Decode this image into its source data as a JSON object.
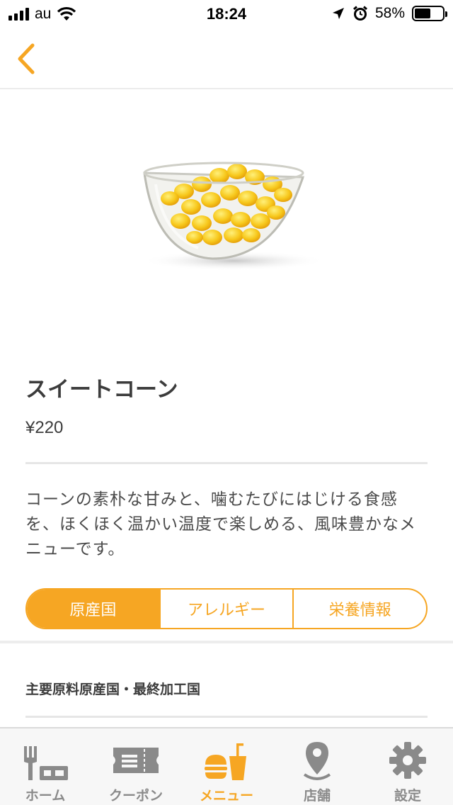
{
  "status_bar": {
    "carrier": "au",
    "time": "18:24",
    "battery_text": "58%",
    "battery_level": 0.58
  },
  "nav": {
    "back_icon": "chevron-left-icon"
  },
  "product": {
    "name": "スイートコーン",
    "price": "¥220",
    "description": "コーンの素朴な甘みと、噛むたびにはじける食感を、ほくほく温かい温度で楽しめる、風味豊かなメニューです。"
  },
  "tabs": [
    {
      "label": "原産国",
      "active": true
    },
    {
      "label": "アレルギー",
      "active": false
    },
    {
      "label": "栄養情報",
      "active": false
    }
  ],
  "section": {
    "title": "主要原料原産国・最終加工国"
  },
  "tab_bar": {
    "items": [
      {
        "label": "ホーム",
        "icon": "home-icon"
      },
      {
        "label": "クーポン",
        "icon": "coupon-icon"
      },
      {
        "label": "メニュー",
        "icon": "menu-icon",
        "active": true
      },
      {
        "label": "店舗",
        "icon": "location-pin-icon"
      },
      {
        "label": "設定",
        "icon": "gear-icon"
      }
    ]
  },
  "colors": {
    "accent": "#f6a623",
    "inactive": "#8a8a8a"
  }
}
